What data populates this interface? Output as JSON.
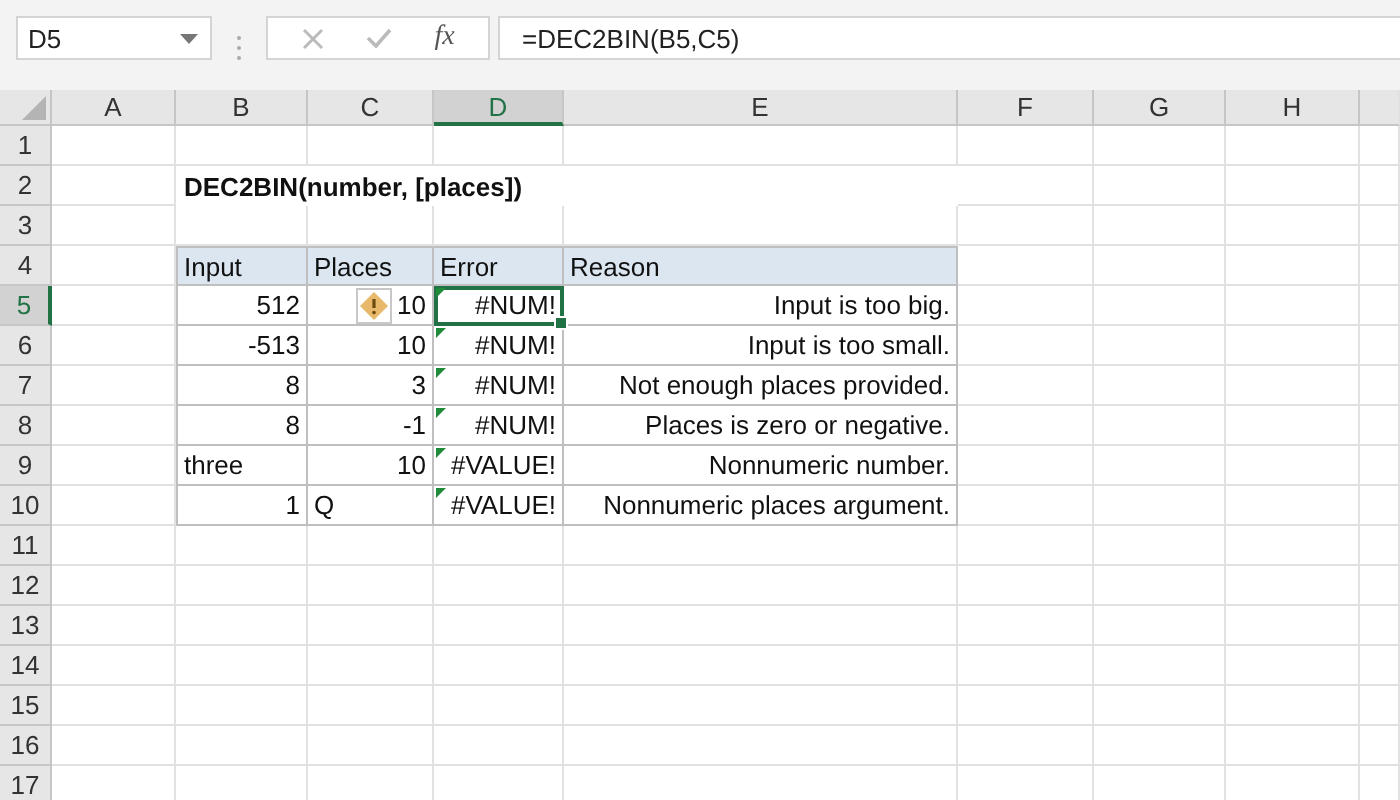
{
  "formula_bar": {
    "name_box": "D5",
    "function_label": "fx",
    "formula": "=DEC2BIN(B5,C5)"
  },
  "column_headers": [
    {
      "label": "A",
      "selected": false
    },
    {
      "label": "B",
      "selected": false
    },
    {
      "label": "C",
      "selected": false
    },
    {
      "label": "D",
      "selected": true
    },
    {
      "label": "E",
      "selected": false
    },
    {
      "label": "F",
      "selected": false
    },
    {
      "label": "G",
      "selected": false
    },
    {
      "label": "H",
      "selected": false
    }
  ],
  "row_headers": [
    {
      "label": "1",
      "selected": false
    },
    {
      "label": "2",
      "selected": false
    },
    {
      "label": "3",
      "selected": false
    },
    {
      "label": "4",
      "selected": false
    },
    {
      "label": "5",
      "selected": true
    },
    {
      "label": "6",
      "selected": false
    },
    {
      "label": "7",
      "selected": false
    },
    {
      "label": "8",
      "selected": false
    },
    {
      "label": "9",
      "selected": false
    },
    {
      "label": "10",
      "selected": false
    },
    {
      "label": "11",
      "selected": false
    },
    {
      "label": "12",
      "selected": false
    },
    {
      "label": "13",
      "selected": false
    },
    {
      "label": "14",
      "selected": false
    },
    {
      "label": "15",
      "selected": false
    },
    {
      "label": "16",
      "selected": false
    },
    {
      "label": "17",
      "selected": false
    }
  ],
  "title": "DEC2BIN(number, [places])",
  "table": {
    "columns": [
      "Input",
      "Places",
      "Error",
      "Reason"
    ],
    "rows": [
      [
        {
          "text": "512",
          "kind": "number"
        },
        {
          "text": "10",
          "kind": "number",
          "warning": true
        },
        {
          "text": "#NUM!",
          "kind": "error",
          "error_flag": true,
          "active": true
        },
        {
          "text": "Input is too big.",
          "kind": "note"
        }
      ],
      [
        {
          "text": "-513",
          "kind": "number"
        },
        {
          "text": "10",
          "kind": "number"
        },
        {
          "text": "#NUM!",
          "kind": "error",
          "error_flag": true
        },
        {
          "text": "Input is too small.",
          "kind": "note"
        }
      ],
      [
        {
          "text": "8",
          "kind": "number"
        },
        {
          "text": "3",
          "kind": "number"
        },
        {
          "text": "#NUM!",
          "kind": "error",
          "error_flag": true
        },
        {
          "text": "Not enough places provided.",
          "kind": "note"
        }
      ],
      [
        {
          "text": "8",
          "kind": "number"
        },
        {
          "text": "-1",
          "kind": "number"
        },
        {
          "text": "#NUM!",
          "kind": "error",
          "error_flag": true
        },
        {
          "text": "Places is zero or negative.",
          "kind": "note"
        }
      ],
      [
        {
          "text": "three",
          "kind": "text"
        },
        {
          "text": "10",
          "kind": "number"
        },
        {
          "text": "#VALUE!",
          "kind": "error",
          "error_flag": true
        },
        {
          "text": "Nonnumeric number.",
          "kind": "note"
        }
      ],
      [
        {
          "text": "1",
          "kind": "number"
        },
        {
          "text": "Q",
          "kind": "text"
        },
        {
          "text": "#VALUE!",
          "kind": "error",
          "error_flag": true
        },
        {
          "text": "Nonnumeric places argument.",
          "kind": "note"
        }
      ]
    ]
  }
}
